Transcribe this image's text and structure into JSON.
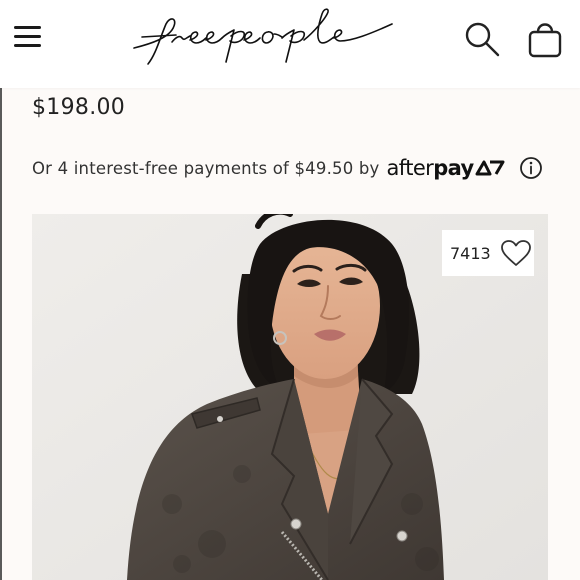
{
  "header": {
    "brand": "free people",
    "icons": {
      "menu": "hamburger-menu-icon",
      "search": "search-icon",
      "bag": "shopping-bag-icon"
    }
  },
  "product": {
    "price": "$198.00",
    "afterpay": {
      "text": "Or 4 interest-free payments of $49.50 by",
      "brand_regular": "after",
      "brand_bold": "pay",
      "info_icon": "info-icon"
    },
    "favorites": {
      "count": "7413",
      "icon": "heart-icon"
    },
    "image_icon": "product-photo"
  },
  "colors": {
    "background": "#fdfaf8",
    "text": "#222222",
    "jacket": "#4d4640",
    "photo_bg": "#ebe9e6"
  }
}
